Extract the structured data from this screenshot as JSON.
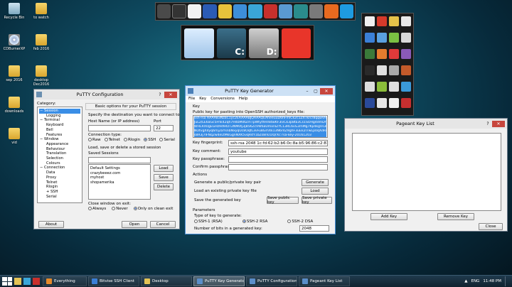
{
  "desktop": {
    "icons": [
      {
        "label": "Recycle Bin",
        "kind": "bin"
      },
      {
        "label": "to watch",
        "kind": "folder"
      },
      {
        "label": "CDBurnerXP",
        "kind": "cd"
      },
      {
        "label": "feb 2016",
        "kind": "folder"
      },
      {
        "label": "sep 2016",
        "kind": "folder"
      },
      {
        "label": "desktop Dec2016",
        "kind": "folder"
      },
      {
        "label": "downloads",
        "kind": "folder"
      },
      {
        "label": "vid",
        "kind": "folder"
      }
    ],
    "dock_mid_labels": [
      "",
      "C:",
      "D:",
      ""
    ]
  },
  "putty": {
    "title": "PuTTY Configuration",
    "category_label": "Category:",
    "tree": [
      "− Session",
      "Logging",
      "− Terminal",
      "Keyboard",
      "Bell",
      "Features",
      "− Window",
      "Appearance",
      "Behaviour",
      "Translation",
      "Selection",
      "Colours",
      "− Connection",
      "Data",
      "Proxy",
      "Telnet",
      "Rlogin",
      "+ SSH",
      "Serial"
    ],
    "header": "Basic options for your PuTTY session",
    "dest_label": "Specify the destination you want to connect to",
    "host_label": "Host Name (or IP address)",
    "port_label": "Port",
    "host_value": "",
    "port_value": "22",
    "conn_type_label": "Connection type:",
    "conn_types": [
      "Raw",
      "Telnet",
      "Rlogin",
      "SSH",
      "Serial"
    ],
    "sessions_label": "Load, save or delete a stored session",
    "saved_label": "Saved Sessions",
    "sessions": [
      "Default Settings",
      "crazybeeez.com",
      "myhost",
      "shopamerika"
    ],
    "load": "Load",
    "save": "Save",
    "delete": "Delete",
    "close_exit_label": "Close window on exit:",
    "close_opts": [
      "Always",
      "Never",
      "Only on clean exit"
    ],
    "about": "About",
    "open": "Open",
    "cancel": "Cancel"
  },
  "keygen": {
    "title": "PuTTY Key Generator",
    "menu": [
      "File",
      "Key",
      "Conversions",
      "Help"
    ],
    "key_label": "Key",
    "pubkey_label": "Public key for pasting into OpenSSH authorized_keys file:",
    "pubkey_lines": [
      "ssh-rsa AAAAB3NzaC1yc2EAAAABJQAAAQEAheeuuD6hFmlCk2c1ZXTkrcr8qqwVR3Rz3wOUQlOqq8sPlhqXH04I2bW6IaXeIM3CJ",
      "JuL2/LE6aGc5Fhk42qh7H4bMdtZmTpWtytfeV84wKF3ivCk3p8ta3Cs1SOHg4dmDf7dWplnl1N8X",
      "WHLRX0gEGHz9d94zT2NM0tj3j85KZcVW6aUmxnlZYC13RC6vG3mMg7Kp4kgVs3B7v9Ko+u",
      "NOtvgX4yq6mj2aYsnbNxyqUc8OqfL3vFu8GmXk13N6r4Z9ghF3uEk2I7wLp0qXdRs9H6q9LdCfaX",
      "s8R3j7lFNq2w4eLtMkGgnNXK5vqR4Y1bZs8nU1lQrXc rsa-key-20161203"
    ],
    "fingerprint_label": "Key fingerprint:",
    "fingerprint": "ssh-rsa 2048 1c:fd:62:b2:b6:0c:8a:b5:96:86:c2:81:49:c2:c2:68",
    "comment_label": "Key comment:",
    "comment": "youtube",
    "passphrase_label": "Key passphrase:",
    "confirm_label": "Confirm passphrase:",
    "actions_label": "Actions",
    "gen_label": "Generate a public/private key pair",
    "gen_btn": "Generate",
    "load_label": "Load an existing private key file",
    "load_btn": "Load",
    "save_label": "Save the generated key",
    "save_pub_btn": "Save public key",
    "save_priv_btn": "Save private key",
    "params_label": "Parameters",
    "type_label": "Type of key to generate:",
    "types": [
      "SSH-1 (RSA)",
      "SSH-2 RSA",
      "SSH-2 DSA"
    ],
    "bits_label": "Number of bits in a generated key:",
    "bits": "2048"
  },
  "pageant": {
    "title": "Pageant Key List",
    "add": "Add Key",
    "remove": "Remove Key",
    "close": "Close"
  },
  "taskbar": {
    "items": [
      {
        "label": "Everything",
        "color": "#e58a2b",
        "active": false
      },
      {
        "label": "Bitvise SSH Client",
        "color": "#3b7fd6",
        "active": false
      },
      {
        "label": "Desktop",
        "color": "#e3c356",
        "active": false
      },
      {
        "label": "PuTTY Key Generator",
        "color": "#5b8ec9",
        "active": true
      },
      {
        "label": "PuTTY Configuration",
        "color": "#5b8ec9",
        "active": false
      },
      {
        "label": "Pageant Key List",
        "color": "#5b8ec9",
        "active": false
      }
    ],
    "lang": "ENG",
    "time": "11:48 PM"
  },
  "colors": {
    "title_active": "#cde1f5",
    "title_inactive": "#e6e6e6",
    "selection": "#3a8ee6"
  }
}
